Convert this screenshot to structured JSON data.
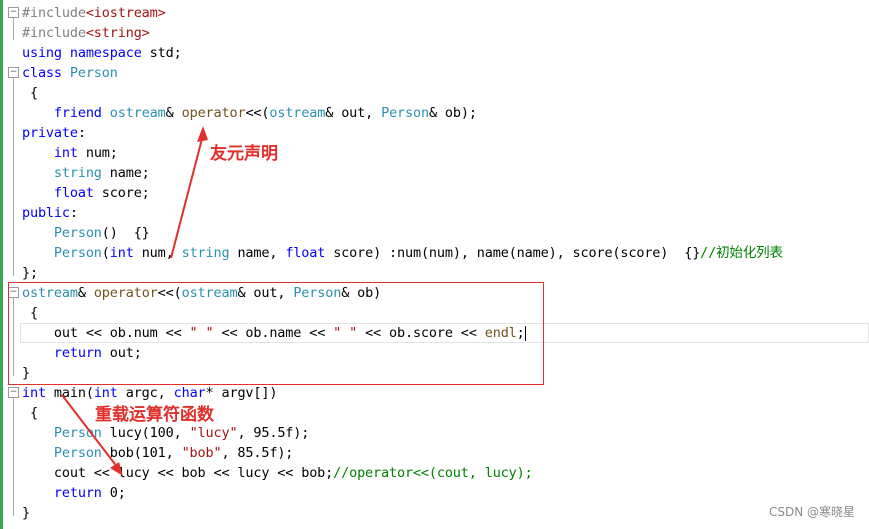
{
  "editor": {
    "lines": [
      "#include<iostream>",
      "#include<string>",
      "using namespace std;",
      "class Person",
      " {",
      "    friend ostream& operator<<(ostream& out, Person& ob);",
      "private:",
      "    int num;",
      "    string name;",
      "    float score;",
      "public:",
      "    Person()  {}",
      "    Person(int num, string name, float score) :num(num), name(name), score(score)  {}//初始化列表",
      "};",
      "ostream& operator<<(ostream& out, Person& ob)",
      " {",
      "    out << ob.num << \" \" << ob.name << \" \" << ob.score << endl;",
      "    return out;",
      "}",
      "int main(int argc, char* argv[])",
      " {",
      "    Person lucy(100, \"lucy\", 95.5f);",
      "    Person bob(101, \"bob\", 85.5f);",
      "    cout << lucy << bob << lucy << bob;//operator<<(cout, lucy);",
      "    return 0;",
      "}"
    ]
  },
  "annotations": {
    "friend_decl": "友元声明",
    "overload_func": "重载运算符函数"
  },
  "watermark": "CSDN @寒晓星",
  "colors": {
    "keyword": "#0000ff",
    "type": "#2b91af",
    "string": "#a31515",
    "comment": "#008000",
    "annotation": "#e0302c",
    "gutter": "#34a853"
  }
}
